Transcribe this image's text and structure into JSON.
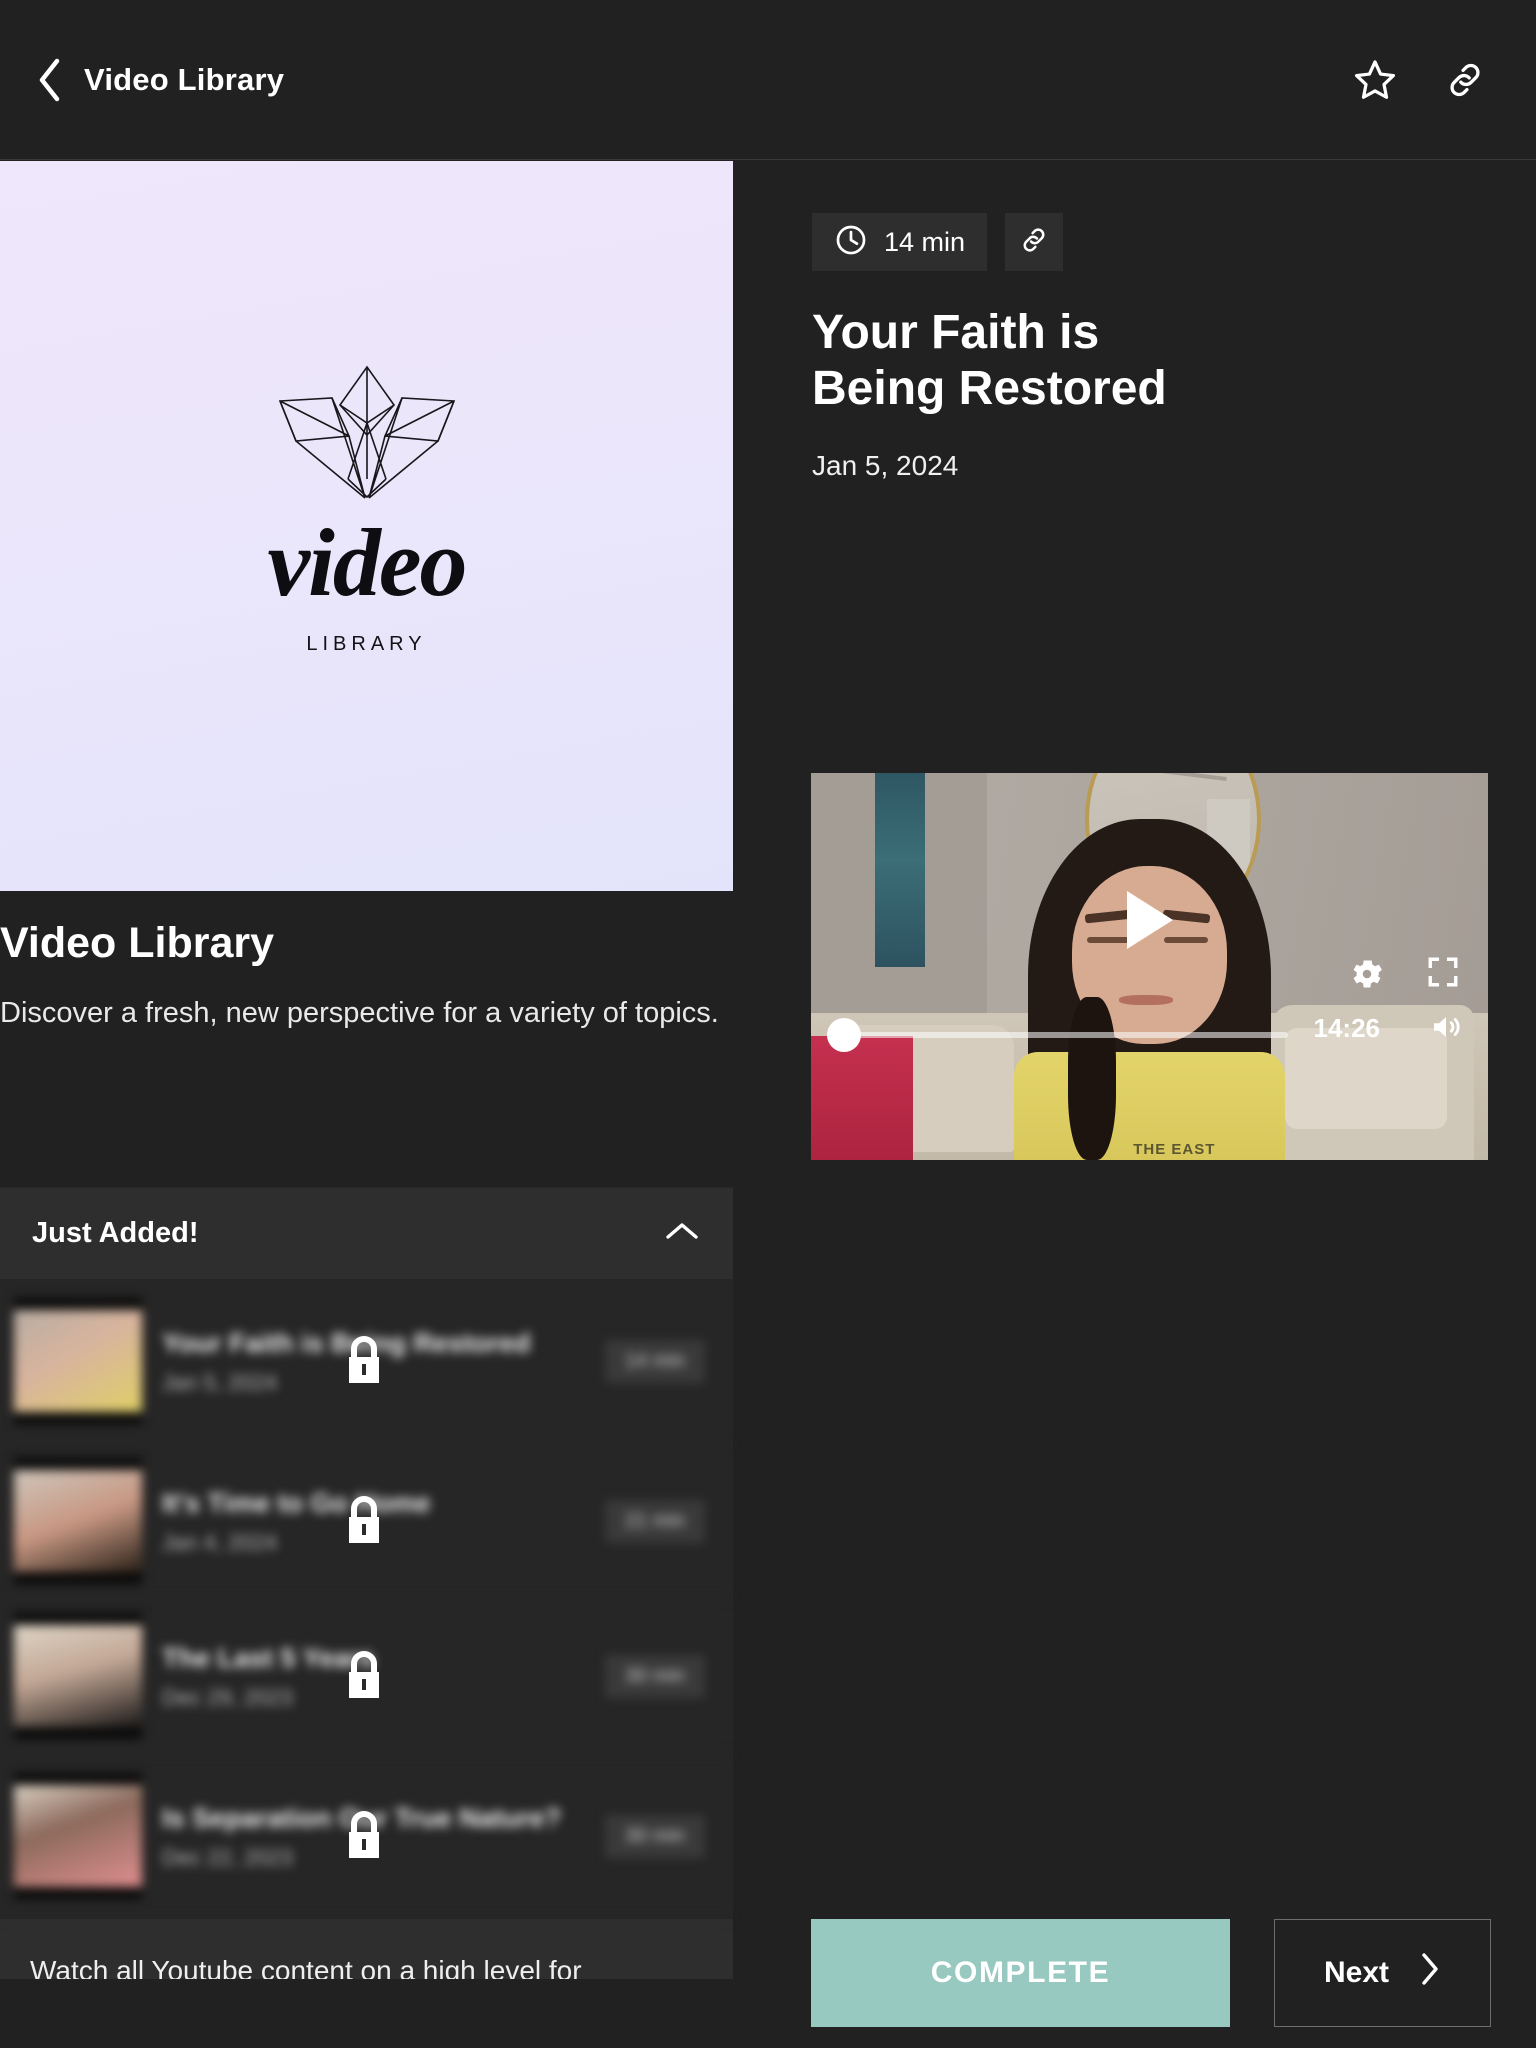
{
  "topbar": {
    "back_icon": "chevron-left-icon",
    "title": "Video Library",
    "favorite_icon": "star-icon",
    "share_icon": "link-icon"
  },
  "hero": {
    "logo_word": "video",
    "logo_sub": "LIBRARY",
    "logo_mark_icon": "crystal-leaf-icon",
    "background_start": "#efe7fb",
    "background_end": "#e3e4fb"
  },
  "left": {
    "title": "Video Library",
    "description": "Discover a fresh, new perspective for a variety of topics."
  },
  "accordion": {
    "title": "Just Added!",
    "collapse_icon": "chevron-up-icon",
    "items": [
      {
        "title": "Your Faith is Being Restored",
        "date": "Jan 5, 2024",
        "duration": "14 min",
        "lock_icon": "lock-icon"
      },
      {
        "title": "It's Time to Go Home",
        "date": "Jan 4, 2024",
        "duration": "21 min",
        "lock_icon": "lock-icon"
      },
      {
        "title": "The Last 5 Years",
        "date": "Dec 29, 2023",
        "duration": "30 min",
        "lock_icon": "lock-icon"
      },
      {
        "title": "Is Separation Our True Nature?",
        "date": "Dec 22, 2023",
        "duration": "30 min",
        "lock_icon": "lock-icon"
      }
    ],
    "footer_note": "Watch all Youtube content on a high level for"
  },
  "detail": {
    "clock_icon": "clock-icon",
    "duration": "14 min",
    "share_icon": "link-icon",
    "title": "Your Faith is Being Restored",
    "date": "Jan 5, 2024"
  },
  "player": {
    "play_icon": "play-icon",
    "settings_icon": "gear-icon",
    "fullscreen_icon": "fullscreen-icon",
    "volume_icon": "volume-icon",
    "time_remaining": "14:26",
    "progress_percent": 0,
    "shirt_text": "THE EAST"
  },
  "footer": {
    "complete_label": "COMPLETE",
    "complete_color": "#98c9c1",
    "next_label": "Next",
    "next_icon": "chevron-right-icon"
  }
}
